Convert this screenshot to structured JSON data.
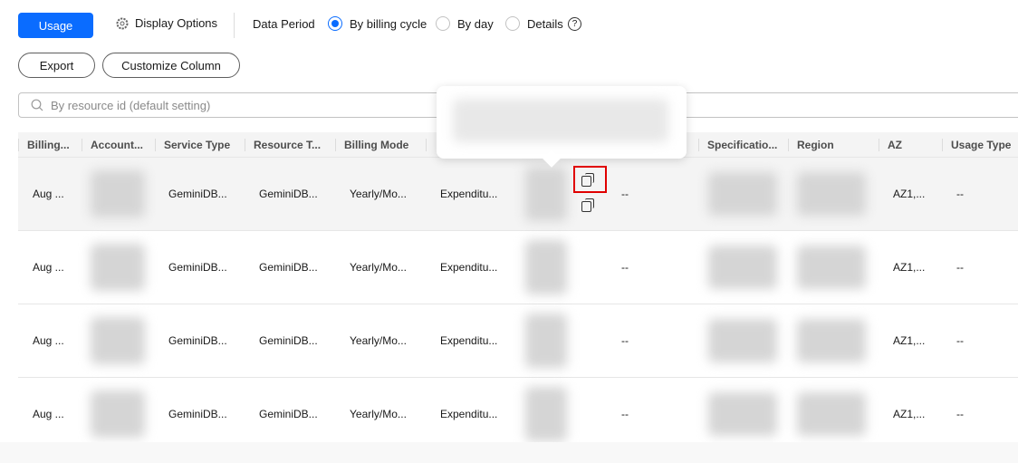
{
  "toolbar": {
    "usage": "Usage",
    "display_options": "Display Options",
    "data_period": "Data Period",
    "radios": [
      {
        "label": "By billing cycle",
        "checked": true
      },
      {
        "label": "By day",
        "checked": false
      },
      {
        "label": "Details",
        "checked": false
      }
    ],
    "help": "?",
    "export": "Export",
    "customize": "Customize Column"
  },
  "search": {
    "placeholder": "By resource id (default setting)"
  },
  "table": {
    "headers": [
      "Billing...",
      "Account...",
      "Service Type",
      "Resource T...",
      "Billing Mode",
      "",
      "",
      "",
      "Specificatio...",
      "Region",
      "AZ",
      "Usage Type"
    ],
    "rows": [
      {
        "billing": "Aug ...",
        "service": "GeminiDB...",
        "resource_type": "GeminiDB...",
        "mode": "Yearly/Mo...",
        "expenditure": "Expenditu...",
        "col8": "--",
        "az": "AZ1,...",
        "usage_type": "--"
      },
      {
        "billing": "Aug ...",
        "service": "GeminiDB...",
        "resource_type": "GeminiDB...",
        "mode": "Yearly/Mo...",
        "expenditure": "Expenditu...",
        "col8": "--",
        "az": "AZ1,...",
        "usage_type": "--"
      },
      {
        "billing": "Aug ...",
        "service": "GeminiDB...",
        "resource_type": "GeminiDB...",
        "mode": "Yearly/Mo...",
        "expenditure": "Expenditu...",
        "col8": "--",
        "az": "AZ1,...",
        "usage_type": "--"
      },
      {
        "billing": "Aug ...",
        "service": "GeminiDB...",
        "resource_type": "GeminiDB...",
        "mode": "Yearly/Mo...",
        "expenditure": "Expenditu...",
        "col8": "--",
        "az": "AZ1,...",
        "usage_type": "--"
      }
    ]
  },
  "colors": {
    "primary": "#0a6cff",
    "highlight": "#e00000"
  }
}
